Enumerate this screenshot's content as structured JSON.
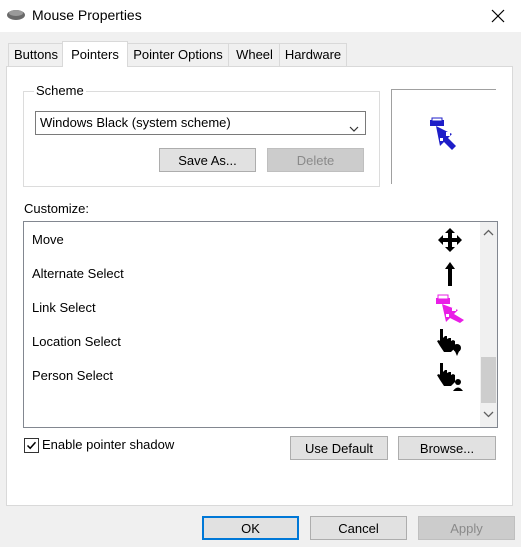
{
  "window": {
    "title": "Mouse Properties",
    "icon": "mouse-icon",
    "close_icon": "close-icon"
  },
  "tabs": [
    {
      "label": "Buttons"
    },
    {
      "label": "Pointers",
      "active": true
    },
    {
      "label": "Pointer Options"
    },
    {
      "label": "Wheel"
    },
    {
      "label": "Hardware"
    }
  ],
  "scheme": {
    "group_label": "Scheme",
    "selected": "Windows Black (system scheme)",
    "save_as": "Save As...",
    "delete": "Delete"
  },
  "customize": {
    "label": "Customize:",
    "items": [
      {
        "label": "Move",
        "cursor_icon": "move-cursor-icon"
      },
      {
        "label": "Alternate Select",
        "cursor_icon": "up-arrow-cursor-icon"
      },
      {
        "label": "Link Select",
        "cursor_icon": "link-select-cursor-icon"
      },
      {
        "label": "Location Select",
        "cursor_icon": "location-select-cursor-icon"
      },
      {
        "label": "Person Select",
        "cursor_icon": "person-select-cursor-icon"
      }
    ]
  },
  "options": {
    "enable_shadow": "Enable pointer shadow",
    "shadow_checked": true,
    "use_default": "Use Default",
    "browse": "Browse..."
  },
  "footer": {
    "ok": "OK",
    "cancel": "Cancel",
    "apply": "Apply"
  },
  "colors": {
    "accent": "#0078d7",
    "preview_cursor": "#1e1ec8",
    "link_cursor": "#e91ee6"
  }
}
